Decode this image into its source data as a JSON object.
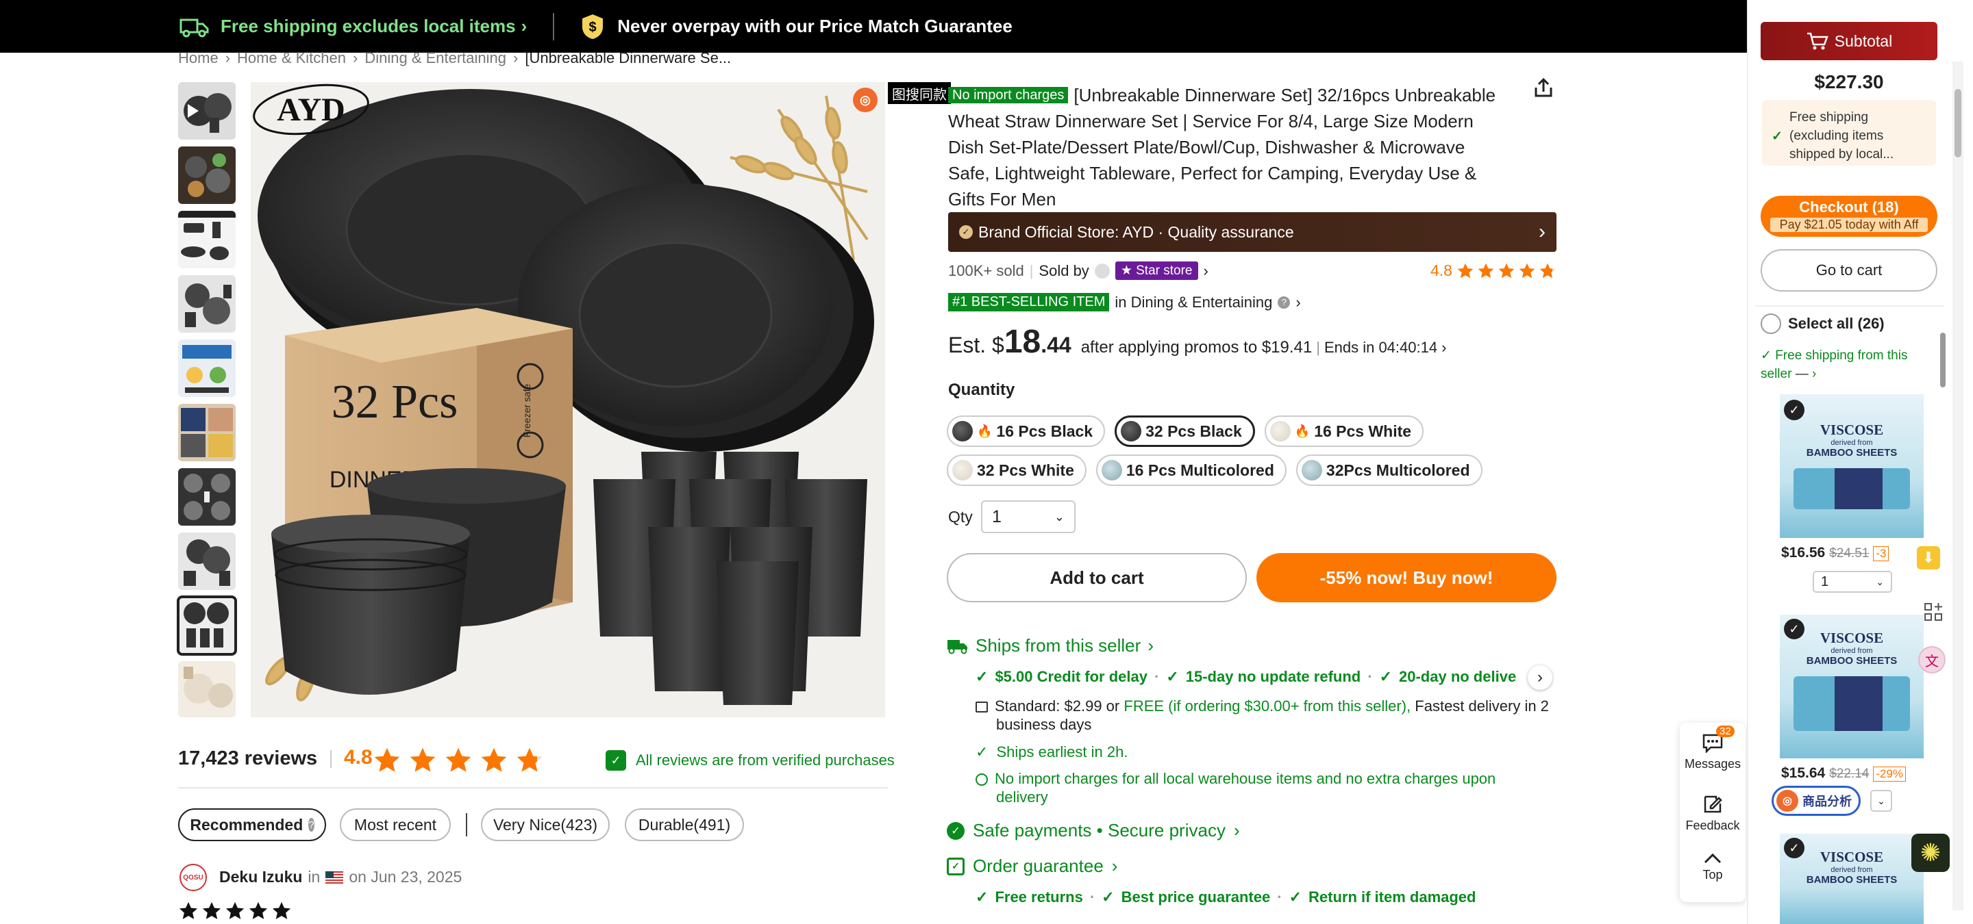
{
  "banner": {
    "shipping_text": "Free shipping excludes local items",
    "price_match_text": "Never overpay with our Price Match Guarantee"
  },
  "breadcrumb": [
    "Home",
    "Home & Kitchen",
    "Dining & Entertaining",
    "[Unbreakable Dinnerware Se..."
  ],
  "gallery": {
    "brand_logo": "AYD",
    "box_text": "32 Pcs",
    "box_subtext": "DINNER",
    "box_side_text": "Freezer safe",
    "overlay_search_label": "图搜同款"
  },
  "reviews": {
    "count_label": "17,423 reviews",
    "rating": "4.8",
    "stars": 4.8,
    "verified_text": "All reviews are from verified purchases",
    "filters": [
      "Recommended",
      "Most recent",
      "Very Nice(423)",
      "Durable(491)"
    ],
    "first_review": {
      "avatar_text": "QOSU",
      "author": "Deku Izuku",
      "in_text": "in",
      "date": "on Jun 23, 2025",
      "stars": 5
    }
  },
  "product": {
    "import_badge": "No import charges",
    "title": "[Unbreakable Dinnerware Set] 32/16pcs Unbreakable Wheat Straw Dinnerware Set | Service For 8/4, Large Size Modern Dish Set-Plate/Dessert Plate/Bowl/Cup, Dishwasher & Microwave Safe, Lightweight Tableware, Perfect for Camping, Everyday Use & Gifts For Men",
    "brand_store": "Brand Official Store: AYD · Quality assurance",
    "sold": "100K+ sold",
    "sold_by": "Sold by",
    "star_store": "Star store",
    "rating": "4.8",
    "bestseller_badge": "#1 BEST-SELLING ITEM",
    "bestseller_category": "in Dining & Entertaining",
    "price_prefix": "Est. $",
    "price_whole": "18",
    "price_cents": ".44",
    "promo_text": "after applying promos to $19.41",
    "ends_text": "Ends in 04:40:14",
    "quantity_label": "Quantity",
    "options_row1": [
      "16 Pcs Black",
      "32 Pcs Black",
      "16 Pcs White"
    ],
    "options_row2": [
      "32 Pcs White",
      "16 Pcs Multicolored",
      "32Pcs Multicolored"
    ],
    "selected_option": "32 Pcs Black",
    "qty_label": "Qty",
    "qty_value": "1",
    "add_to_cart": "Add to cart",
    "buy_now": "-55% now! Buy now!"
  },
  "shipping": {
    "ships_from": "Ships from this seller",
    "guarantees": [
      "$5.00 Credit for delay",
      "15-day no update refund",
      "20-day no delive"
    ],
    "standard_prefix": "Standard: $2.99 or",
    "standard_free": "FREE (if ordering $30.00+ from this seller),",
    "standard_fast": "Fastest delivery in 2",
    "standard_days": "business days",
    "earliest": "Ships earliest in 2h.",
    "no_import": "No import charges for all local warehouse items and no extra charges upon",
    "no_import_2": "delivery",
    "safe_payments": "Safe payments • Secure privacy",
    "order_guarantee": "Order guarantee",
    "order_items": [
      "Free returns",
      "Best price guarantee",
      "Return if item damaged"
    ]
  },
  "float_tools": {
    "messages": "Messages",
    "messages_count": "32",
    "feedback": "Feedback",
    "top": "Top"
  },
  "cart": {
    "subtotal_label": "Subtotal",
    "subtotal_value": "$227.30",
    "free_shipping_note": "Free shipping (excluding items shipped by local...",
    "checkout_label": "Checkout (18)",
    "checkout_sub": "Pay $21.05 today with Aff",
    "go_to_cart": "Go to cart",
    "select_all": "Select all (26)",
    "free_from_seller": "Free shipping from this seller",
    "product_brand": "VISCOSE",
    "product_sub": "derived from",
    "product_name": "BAMBOO SHEETS",
    "items": [
      {
        "price": "$16.56",
        "old_price": "$24.51",
        "discount": "-3",
        "qty": "1"
      },
      {
        "price": "$15.64",
        "old_price": "$22.14",
        "discount": "-29%",
        "qty": ""
      },
      {
        "price": "",
        "old_price": "",
        "discount": "",
        "qty": ""
      }
    ],
    "analysis_badge": "商品分析"
  }
}
